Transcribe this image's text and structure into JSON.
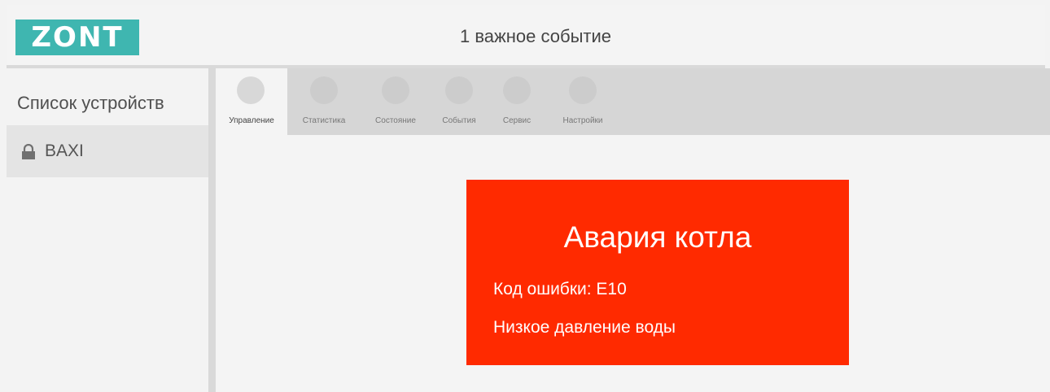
{
  "header": {
    "logo_text": "ZONT",
    "events_title": "1 важное событие"
  },
  "sidebar": {
    "title": "Список устройств",
    "devices": [
      {
        "name": "BAXI",
        "icon": "lock-icon",
        "selected": true
      }
    ]
  },
  "tabs": [
    {
      "label": "Управление",
      "active": true
    },
    {
      "label": "Статистика",
      "active": false
    },
    {
      "label": "Состояние",
      "active": false
    },
    {
      "label": "События",
      "active": false
    },
    {
      "label": "Сервис",
      "active": false
    },
    {
      "label": "Настройки",
      "active": false
    }
  ],
  "alarm": {
    "title": "Авария котла",
    "code_text": "Код ошибки: E10",
    "description": "Низкое давление воды"
  },
  "colors": {
    "brand": "#3fb6b0",
    "alarm": "#ff2a00"
  }
}
